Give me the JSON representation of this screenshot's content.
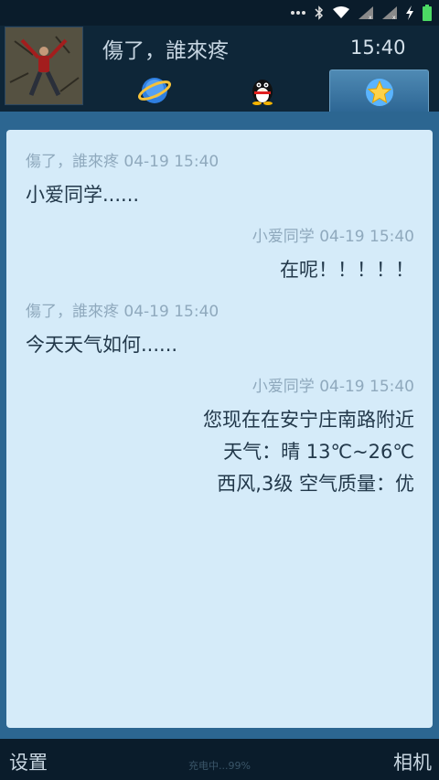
{
  "status_bar": {
    "icons": [
      "more-dots-icon",
      "bluetooth-icon",
      "wifi-icon",
      "signal-1-icon",
      "signal-2-icon",
      "charging-icon",
      "battery-icon"
    ],
    "battery_color": "#4cd964"
  },
  "header": {
    "contact_name": "傷了，誰來疼",
    "time": "15:40",
    "tabs": [
      {
        "icon": "ie-globe-icon",
        "active": false
      },
      {
        "icon": "qq-penguin-icon",
        "active": false
      },
      {
        "icon": "star-icon",
        "active": true
      }
    ]
  },
  "messages": [
    {
      "side": "left",
      "sender": "傷了，誰來疼",
      "time": "04-19 15:40",
      "lines": [
        "小爱同学......"
      ]
    },
    {
      "side": "right",
      "sender": "小爱同学",
      "time": "04-19 15:40",
      "lines": [
        "在呢！！！！！"
      ]
    },
    {
      "side": "left",
      "sender": "傷了，誰來疼",
      "time": "04-19 15:40",
      "lines": [
        "今天天气如何......"
      ]
    },
    {
      "side": "right",
      "sender": "小爱同学",
      "time": "04-19 15:40",
      "lines": [
        "您现在在安宁庄南路附近",
        "天气：晴 13℃~26℃",
        "西风,3级 空气质量：优"
      ]
    }
  ],
  "bottom_bar": {
    "settings_label": "设置",
    "camera_label": "相机",
    "charging_text": "充电中...99%"
  },
  "colors": {
    "panel_bg": "#d5ebf9",
    "content_bg": "#2c6691",
    "header_bg": "#0e2638",
    "text": "#22384a",
    "meta_text": "#8fa9bd"
  }
}
